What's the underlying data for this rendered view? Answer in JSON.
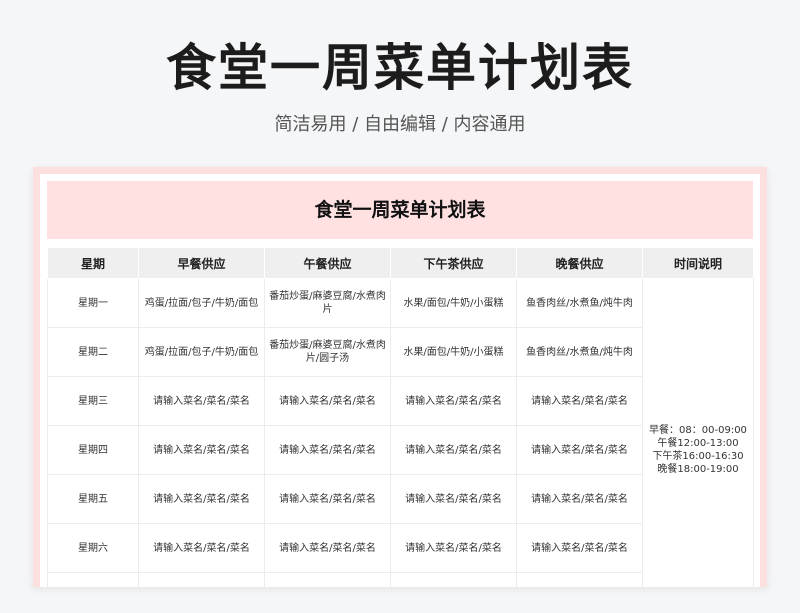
{
  "header": {
    "title": "食堂一周菜单计划表",
    "subtitle": "简洁易用 / 自由编辑 / 内容通用"
  },
  "sheet": {
    "title": "食堂一周菜单计划表",
    "columns": [
      "星期",
      "早餐供应",
      "午餐供应",
      "下午茶供应",
      "晚餐供应",
      "时间说明"
    ],
    "rows": [
      {
        "day": "星期一",
        "breakfast": "鸡蛋/拉面/包子/牛奶/面包",
        "lunch": "番茄炒蛋/麻婆豆腐/水煮肉片",
        "tea": "水果/面包/牛奶/小蛋糕",
        "dinner": "鱼香肉丝/水煮鱼/炖牛肉"
      },
      {
        "day": "星期二",
        "breakfast": "鸡蛋/拉面/包子/牛奶/面包",
        "lunch": "番茄炒蛋/麻婆豆腐/水煮肉片/圆子汤",
        "tea": "水果/面包/牛奶/小蛋糕",
        "dinner": "鱼香肉丝/水煮鱼/炖牛肉"
      },
      {
        "day": "星期三",
        "breakfast": "请输入菜名/菜名/菜名",
        "lunch": "请输入菜名/菜名/菜名",
        "tea": "请输入菜名/菜名/菜名",
        "dinner": "请输入菜名/菜名/菜名"
      },
      {
        "day": "星期四",
        "breakfast": "请输入菜名/菜名/菜名",
        "lunch": "请输入菜名/菜名/菜名",
        "tea": "请输入菜名/菜名/菜名",
        "dinner": "请输入菜名/菜名/菜名"
      },
      {
        "day": "星期五",
        "breakfast": "请输入菜名/菜名/菜名",
        "lunch": "请输入菜名/菜名/菜名",
        "tea": "请输入菜名/菜名/菜名",
        "dinner": "请输入菜名/菜名/菜名"
      },
      {
        "day": "星期六",
        "breakfast": "请输入菜名/菜名/菜名",
        "lunch": "请输入菜名/菜名/菜名",
        "tea": "请输入菜名/菜名/菜名",
        "dinner": "请输入菜名/菜名/菜名"
      }
    ],
    "time_note": [
      "早餐：08：00-09:00",
      "午餐12:00-13:00",
      "下午茶16:00-16:30",
      "晚餐18:00-19:00"
    ]
  },
  "colors": {
    "background": "#f5f6f8",
    "accent_pink": "#ffe1e1",
    "header_gray": "#efefef"
  }
}
